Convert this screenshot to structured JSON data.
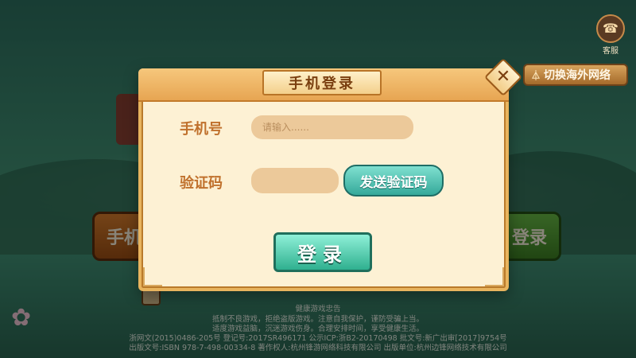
{
  "dialog": {
    "title": "手机登录",
    "close_label": "✕",
    "phone_label": "手机号",
    "phone_placeholder": "请输入......",
    "code_label": "验证码",
    "send_code_label": "发送验证码",
    "login_label": "登录"
  },
  "top_right": {
    "support_label": "客服",
    "overseas_label": "切换海外网络"
  },
  "background_buttons": {
    "left_label": "手机",
    "right_label": "登录"
  },
  "notice": {
    "title": "健康游戏忠告",
    "lines": [
      "抵制不良游戏，拒绝盗版游戏。注意自我保护，谨防受骗上当。",
      "适度游戏益脑，沉迷游戏伤身。合理安排时间，享受健康生活。",
      "浙网文(2015)0486-205号  登记号:2017SR496171  公示ICP:浙B2-20170498  批文号:新广出审[2017]9754号",
      "出版文号:ISBN 978-7-498-00334-8  著作权人:杭州锋游网络科技有限公司  出版单位:杭州边锋网络技术有限公司"
    ]
  },
  "colors": {
    "dialog_bg": "#fdf1d4",
    "header_orange": "#e7a552",
    "label_brown": "#c0712d",
    "teal_button": "#35a99a"
  }
}
